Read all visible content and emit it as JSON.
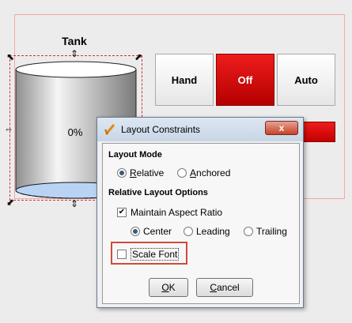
{
  "tank": {
    "title": "Tank",
    "value": "0%"
  },
  "mode_buttons": [
    {
      "label": "Hand",
      "active": false
    },
    {
      "label": "Off",
      "active": true
    },
    {
      "label": "Auto",
      "active": false
    }
  ],
  "dialog": {
    "title": "Layout Constraints",
    "close_label": "x",
    "layout_mode": {
      "heading": "Layout Mode",
      "options": [
        {
          "mnemonic": "R",
          "rest": "elative",
          "selected": true
        },
        {
          "mnemonic": "A",
          "rest": "nchored",
          "selected": false
        }
      ]
    },
    "relative_options": {
      "heading": "Relative Layout Options",
      "maintain_aspect_ratio": {
        "label": "Maintain Aspect Ratio",
        "checked": true
      },
      "alignment": [
        {
          "label": "Center",
          "selected": true
        },
        {
          "label": "Leading",
          "selected": false
        },
        {
          "label": "Trailing",
          "selected": false
        }
      ],
      "scale_font": {
        "label": "Scale Font",
        "checked": false
      }
    },
    "ok": {
      "mnemonic": "O",
      "rest": "K"
    },
    "cancel": {
      "mnemonic": "C",
      "rest": "ancel"
    }
  },
  "colors": {
    "active_red": "#dd0000",
    "tank_fill": "#b9d3f5",
    "highlight_box": "#d24a3a"
  }
}
